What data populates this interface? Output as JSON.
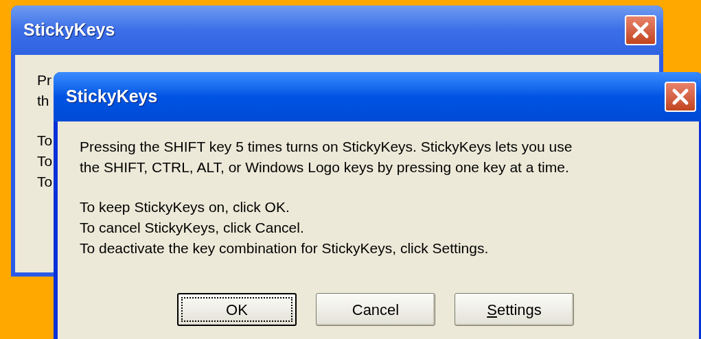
{
  "windows": [
    {
      "title": "StickyKeys",
      "active": false,
      "paragraphs": [
        [
          "Pr",
          "th"
        ],
        [
          "To",
          "To",
          "To"
        ]
      ]
    },
    {
      "title": "StickyKeys",
      "active": true,
      "paragraphs": [
        [
          "Pressing the SHIFT key 5 times turns on StickyKeys. StickyKeys lets you use",
          "the SHIFT, CTRL, ALT, or Windows Logo keys by pressing one key at a time."
        ],
        [
          "To keep StickyKeys on, click OK.",
          "To cancel StickyKeys, click Cancel.",
          "To deactivate the key combination for StickyKeys, click Settings."
        ]
      ],
      "buttons": [
        {
          "label": "OK",
          "focused": true
        },
        {
          "label": "Cancel",
          "focused": false
        },
        {
          "mnemonic": "S",
          "label": "ettings",
          "focused": false
        }
      ]
    }
  ]
}
